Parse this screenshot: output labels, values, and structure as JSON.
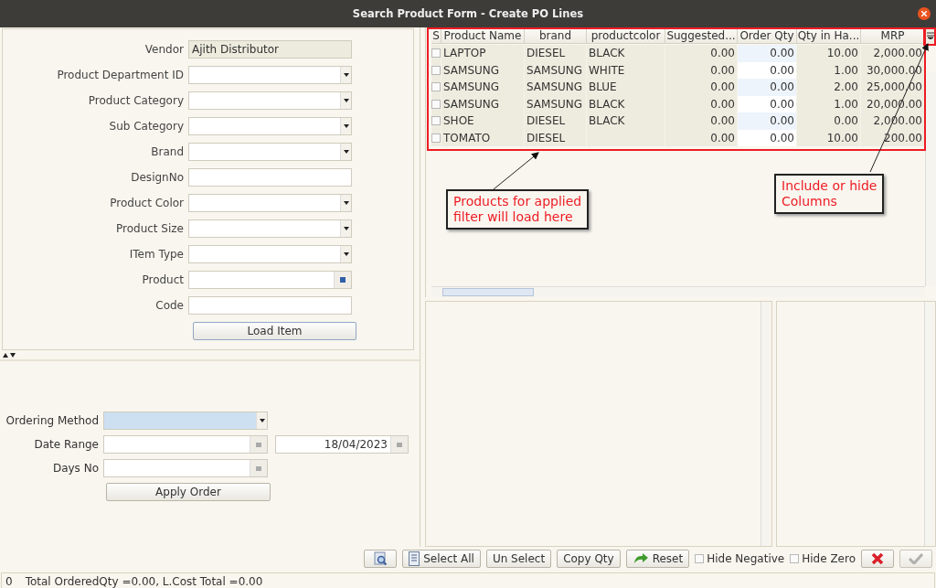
{
  "window": {
    "title": "Search Product Form - Create PO Lines"
  },
  "filter_form": {
    "fields": [
      {
        "label": "Vendor",
        "kind": "readonly",
        "value": "Ajith Distributor"
      },
      {
        "label": "Product Department ID",
        "kind": "dropdown"
      },
      {
        "label": "Product Category",
        "kind": "dropdown"
      },
      {
        "label": "Sub Category",
        "kind": "dropdown"
      },
      {
        "label": "Brand",
        "kind": "dropdown"
      },
      {
        "label": "DesignNo",
        "kind": "text"
      },
      {
        "label": "Product Color",
        "kind": "dropdown"
      },
      {
        "label": "Product Size",
        "kind": "dropdown"
      },
      {
        "label": "ITem Type",
        "kind": "dropdown"
      },
      {
        "label": "Product",
        "kind": "lookup"
      },
      {
        "label": "Code",
        "kind": "text"
      }
    ],
    "load_button": "Load Item"
  },
  "order_form": {
    "ordering_method": {
      "label": "Ordering Method",
      "focused": true
    },
    "date_range": {
      "label": "Date Range",
      "to": "18/04/2023"
    },
    "days_no": {
      "label": "Days No"
    },
    "apply_button": "Apply Order"
  },
  "table": {
    "columns": [
      "S",
      "Product Name",
      "brand",
      "productcolor",
      "Suggested...",
      "Order Qty",
      "Qty in Ha...",
      "MRP"
    ],
    "rows": [
      {
        "checked": false,
        "cells": [
          "",
          "LAPTOP",
          "DIESEL",
          "BLACK",
          "0.00",
          "0.00",
          "10.00",
          "2,000.00"
        ]
      },
      {
        "checked": false,
        "cells": [
          "",
          "SAMSUNG",
          "SAMSUNG",
          "WHITE",
          "0.00",
          "0.00",
          "1.00",
          "30,000.00"
        ]
      },
      {
        "checked": false,
        "cells": [
          "",
          "SAMSUNG",
          "SAMSUNG",
          "BLUE",
          "0.00",
          "0.00",
          "2.00",
          "25,000.00"
        ]
      },
      {
        "checked": false,
        "cells": [
          "",
          "SAMSUNG",
          "SAMSUNG",
          "BLACK",
          "0.00",
          "0.00",
          "1.00",
          "20,000.00"
        ]
      },
      {
        "checked": false,
        "cells": [
          "",
          "SHOE",
          "DIESEL",
          "BLACK",
          "0.00",
          "0.00",
          "0.00",
          "2,000.00"
        ]
      },
      {
        "checked": false,
        "cells": [
          "",
          "TOMATO",
          "DIESEL",
          "",
          "0.00",
          "0.00",
          "10.00",
          "200.00"
        ]
      }
    ]
  },
  "annotations": [
    {
      "lines": [
        "Products for applied",
        "filter will load here"
      ]
    },
    {
      "lines": [
        "Include or hide",
        "Columns"
      ]
    }
  ],
  "toolbar": {
    "buttons": [
      {
        "kind": "search"
      },
      {
        "kind": "select-all",
        "label": "Select All"
      },
      {
        "kind": "text",
        "label": "Un Select"
      },
      {
        "kind": "text",
        "label": "Copy Qty"
      },
      {
        "kind": "reset",
        "label": "Reset"
      }
    ],
    "checkboxes": [
      {
        "label": "Hide Negative",
        "checked": false
      },
      {
        "label": "Hide Zero",
        "checked": false
      }
    ],
    "ok_disabled": true
  },
  "status_bar": {
    "count": "0",
    "summary": "Total OrderedQty =0.00, L.Cost Total =0.00"
  }
}
